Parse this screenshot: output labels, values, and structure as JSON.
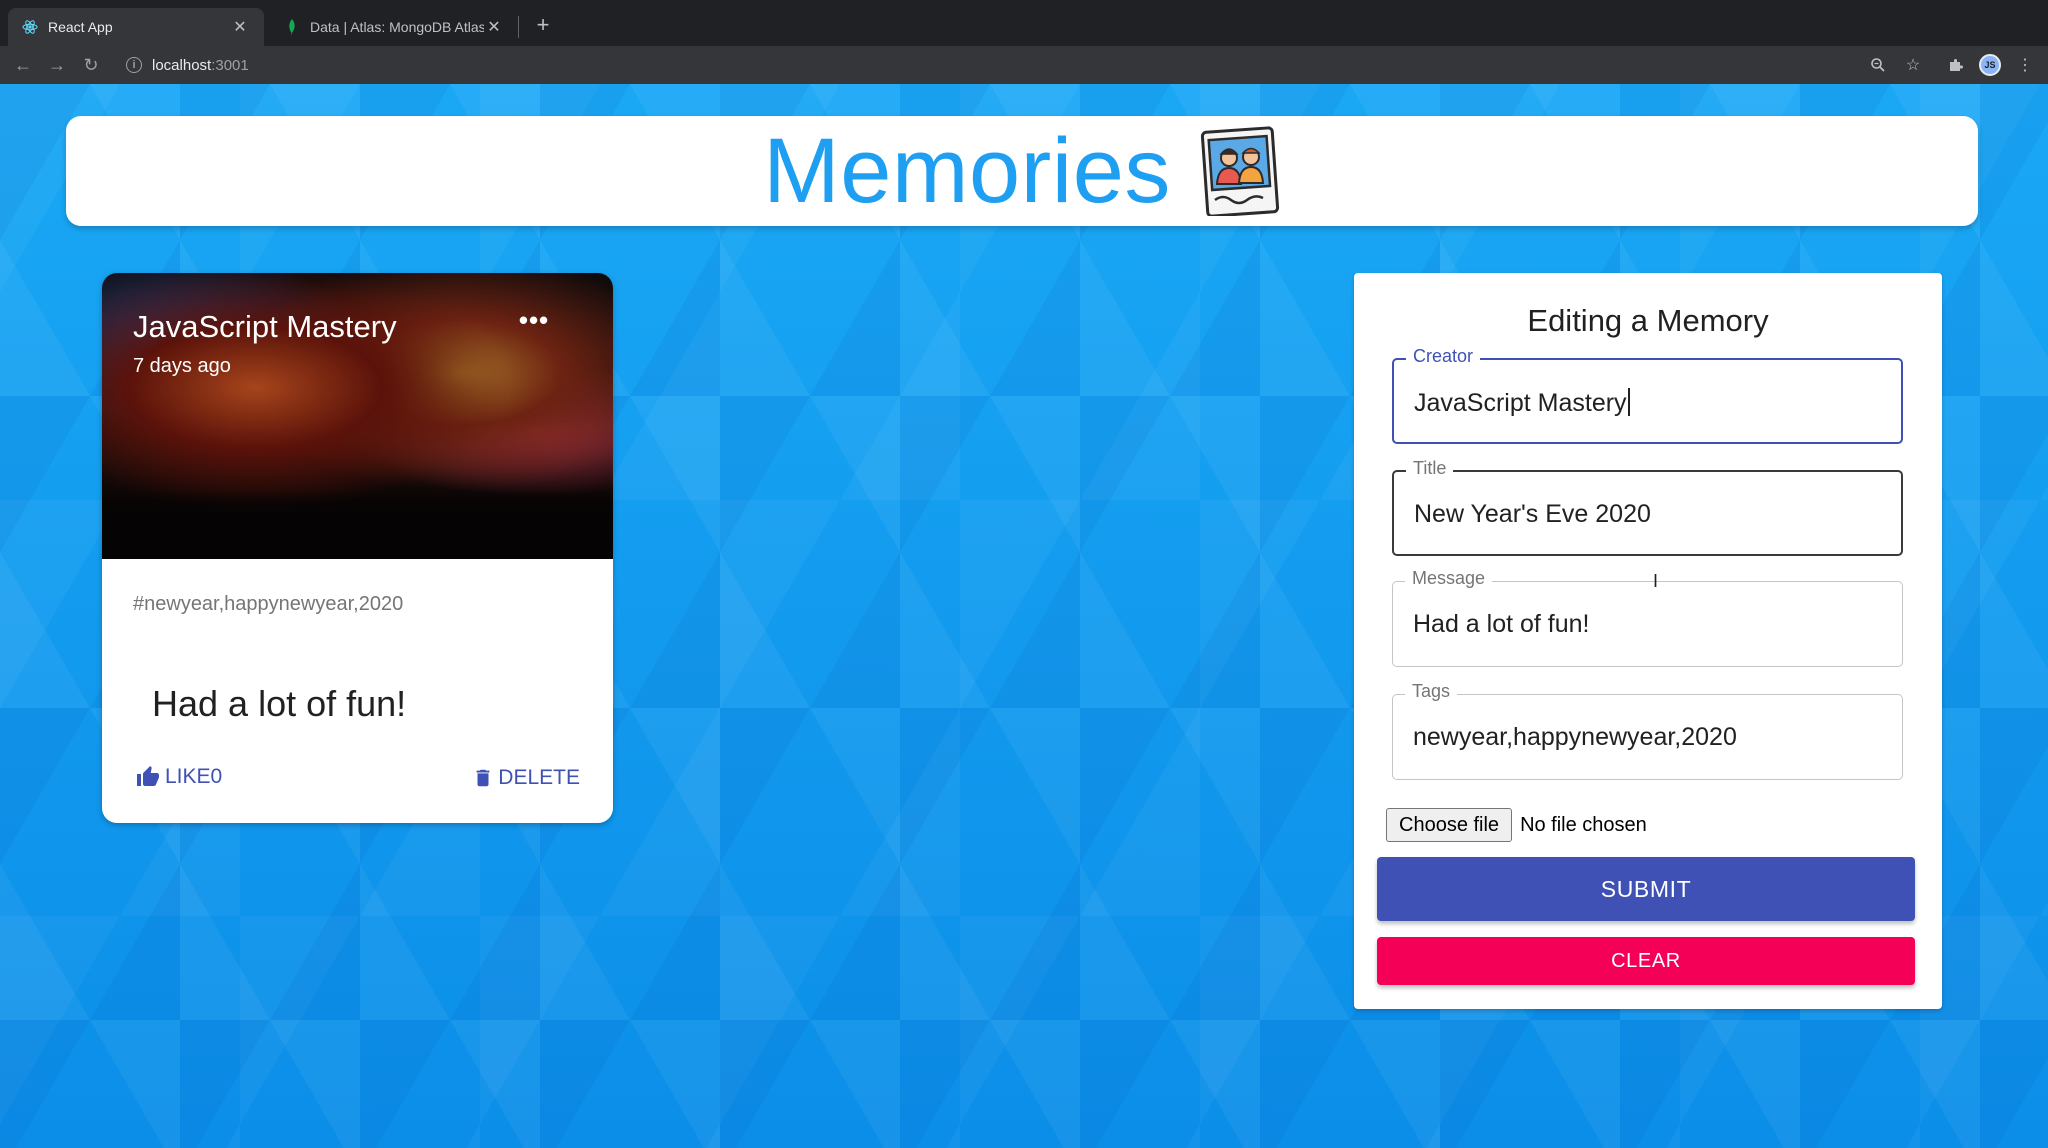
{
  "browser": {
    "tabs": [
      {
        "title": "React App",
        "active": true,
        "icon": "react-icon"
      },
      {
        "title": "Data | Atlas: MongoDB Atlas",
        "active": false,
        "icon": "mongodb-leaf-icon"
      }
    ],
    "url_host": "localhost",
    "url_port": ":3001",
    "profile_initials": "JS"
  },
  "app": {
    "brand": "Memories",
    "logo_icon": "memories-photo-icon"
  },
  "post": {
    "creator": "JavaScript Mastery",
    "time_ago": "7 days ago",
    "tags": "#newyear,happynewyear,2020",
    "message": "Had a lot of fun!",
    "like_label": "LIKE",
    "like_count": "0",
    "delete_label": "DELETE",
    "more_label": "•••"
  },
  "form": {
    "title": "Editing a Memory",
    "creator": {
      "label": "Creator",
      "value": "JavaScript Mastery"
    },
    "title_field": {
      "label": "Title",
      "value": "New Year's Eve 2020"
    },
    "message": {
      "label": "Message",
      "value": "Had a lot of fun!"
    },
    "tags": {
      "label": "Tags",
      "value": "newyear,happynewyear,2020"
    },
    "file_button": "Choose file",
    "file_status": "No file chosen",
    "submit_label": "SUBMIT",
    "clear_label": "CLEAR"
  },
  "colors": {
    "primary": "#3f51b5",
    "secondary": "#f50057",
    "brand": "#1e9ff2",
    "background": "#1ea0f2"
  }
}
